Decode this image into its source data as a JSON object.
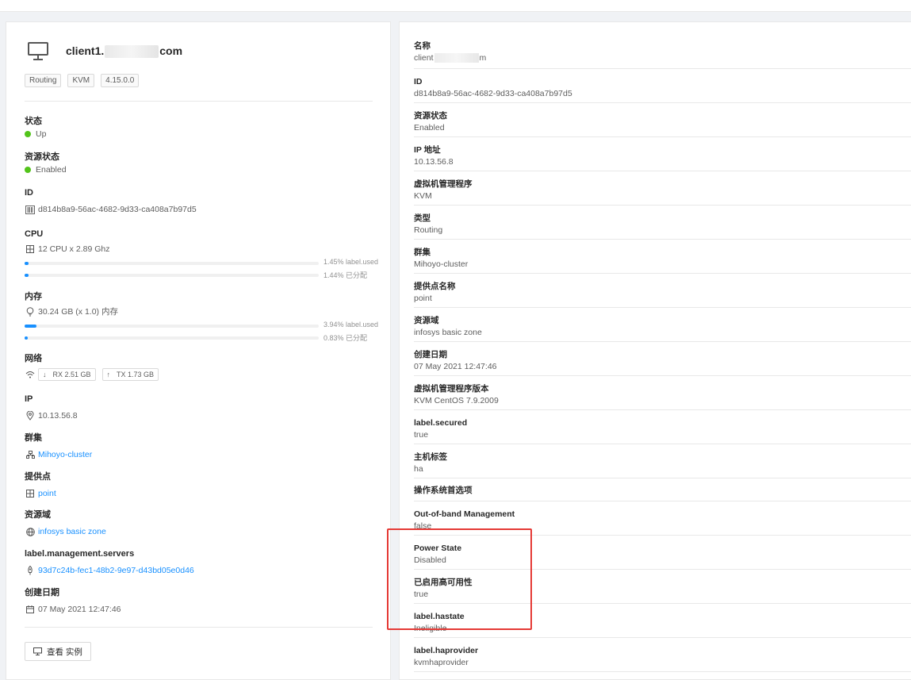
{
  "host": {
    "name_prefix": "client1.",
    "name_suffix": "com",
    "tags": [
      "Routing",
      "KVM",
      "4.15.0.0"
    ]
  },
  "left": {
    "state": {
      "label": "状态",
      "value": "Up"
    },
    "resource_state": {
      "label": "资源状态",
      "value": "Enabled"
    },
    "id": {
      "label": "ID",
      "value": "d814b8a9-56ac-4682-9d33-ca408a7b97d5"
    },
    "cpu": {
      "label": "CPU",
      "value": "12 CPU x 2.89 Ghz",
      "used_percent": 1.45,
      "used_text": "1.45% label.used",
      "allocated_percent": 1.44,
      "allocated_text": "1.44% 已分配"
    },
    "memory": {
      "label": "内存",
      "value": "30.24 GB (x 1.0) 内存",
      "used_percent": 3.94,
      "used_text": "3.94% label.used",
      "allocated_percent": 0.83,
      "allocated_text": "0.83% 已分配"
    },
    "network": {
      "label": "网络",
      "rx": "RX 2.51 GB",
      "tx": "TX 1.73 GB"
    },
    "ip": {
      "label": "IP",
      "value": "10.13.56.8"
    },
    "cluster": {
      "label": "群集",
      "value": "Mihoyo-cluster"
    },
    "pod": {
      "label": "提供点",
      "value": "point"
    },
    "zone": {
      "label": "资源域",
      "value": "infosys basic zone"
    },
    "mgmt": {
      "label": "label.management.servers",
      "value": "93d7c24b-fec1-48b2-9e97-d43bd05e0d46"
    },
    "created": {
      "label": "创建日期",
      "value": "07 May 2021 12:47:46"
    },
    "view_instances": "查看 实例"
  },
  "right": {
    "items": [
      {
        "label": "名称",
        "value_prefix": "client",
        "value_suffix": "m",
        "blur": true
      },
      {
        "label": "ID",
        "value": "d814b8a9-56ac-4682-9d33-ca408a7b97d5"
      },
      {
        "label": "资源状态",
        "value": "Enabled"
      },
      {
        "label": "IP 地址",
        "value": "10.13.56.8"
      },
      {
        "label": "虚拟机管理程序",
        "value": "KVM"
      },
      {
        "label": "类型",
        "value": "Routing"
      },
      {
        "label": "群集",
        "value": "Mihoyo-cluster"
      },
      {
        "label": "提供点名称",
        "value": "point"
      },
      {
        "label": "资源域",
        "value": "infosys basic zone"
      },
      {
        "label": "创建日期",
        "value": "07 May 2021 12:47:46"
      },
      {
        "label": "虚拟机管理程序版本",
        "value": "KVM CentOS 7.9.2009"
      },
      {
        "label": "label.secured",
        "value": "true"
      },
      {
        "label": "主机标签",
        "value": "ha"
      },
      {
        "label": "操作系统首选项",
        "value": ""
      },
      {
        "label": "Out-of-band Management",
        "value": "false"
      },
      {
        "label": "Power State",
        "value": "Disabled"
      },
      {
        "label": "已启用高可用性",
        "value": "true"
      },
      {
        "label": "label.hastate",
        "value": "Ineligible"
      },
      {
        "label": "label.haprovider",
        "value": "kvmhaprovider"
      }
    ]
  },
  "colors": {
    "accent": "#1890ff",
    "ok": "#52c41a",
    "highlight": "#e53935"
  }
}
